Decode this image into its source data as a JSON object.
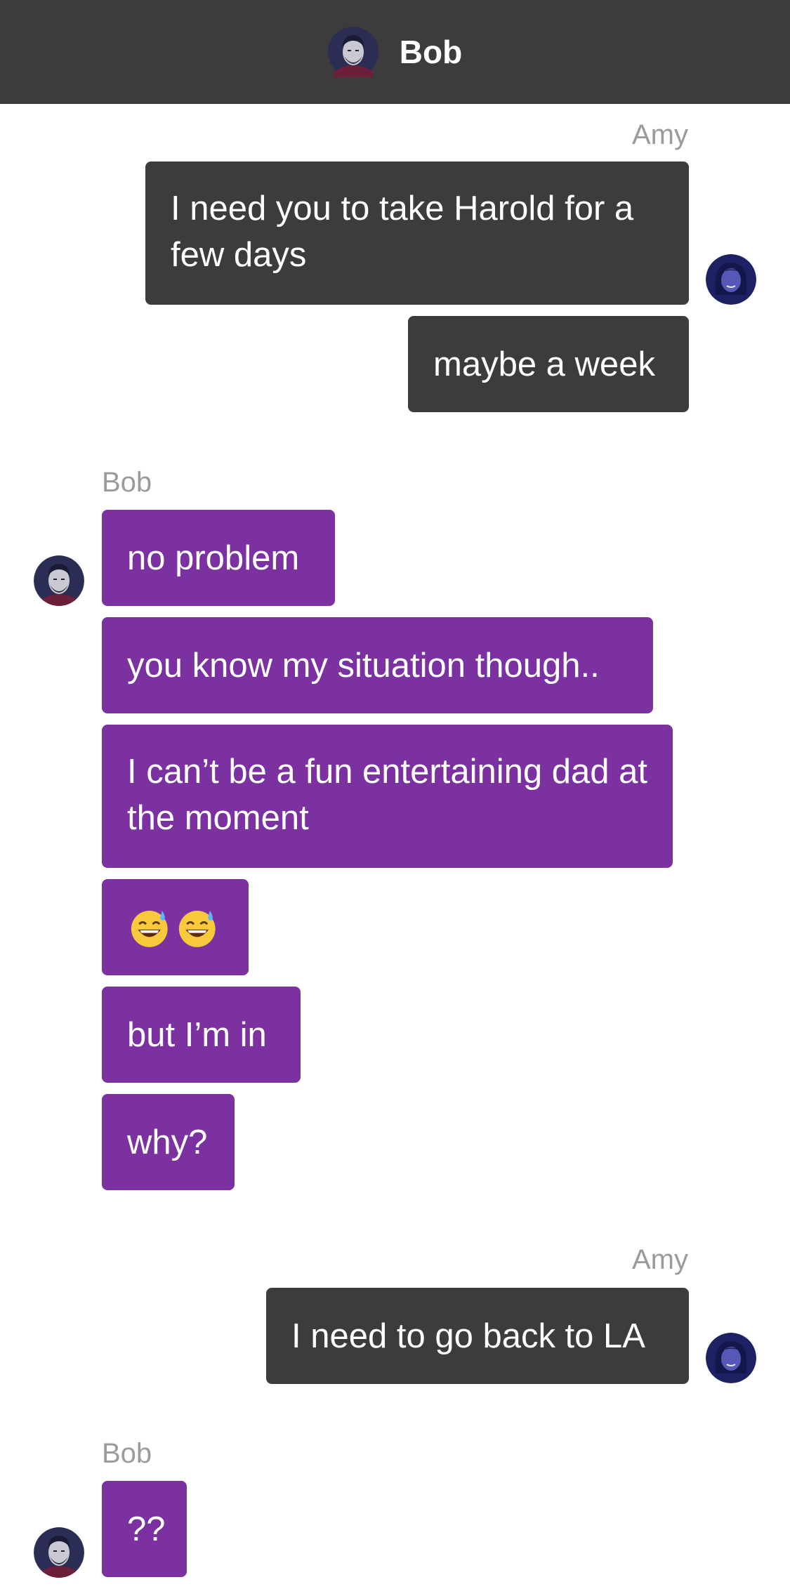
{
  "header": {
    "contact_name": "Bob",
    "avatar_icon": "bob-avatar-icon"
  },
  "colors": {
    "header_bg": "#3c3c3c",
    "outgoing_bubble": "#3c3c3c",
    "incoming_bubble": "#7b31a0",
    "sender_label": "#9b9b9b"
  },
  "messages": [
    {
      "group": 1,
      "sender": "Amy",
      "direction": "outgoing",
      "bubbles": [
        "I need you to take Harold for a few days",
        "maybe a week"
      ]
    },
    {
      "group": 2,
      "sender": "Bob",
      "direction": "incoming",
      "bubbles": [
        "no problem",
        "you know my situation though..",
        "I can’t be a fun entertaining dad at the moment",
        "😅😅",
        "but I’m in",
        "why?"
      ]
    },
    {
      "group": 3,
      "sender": "Amy",
      "direction": "outgoing",
      "bubbles": [
        "I need to go back to LA"
      ]
    },
    {
      "group": 4,
      "sender": "Bob",
      "direction": "incoming",
      "bubbles": [
        "??"
      ]
    }
  ]
}
